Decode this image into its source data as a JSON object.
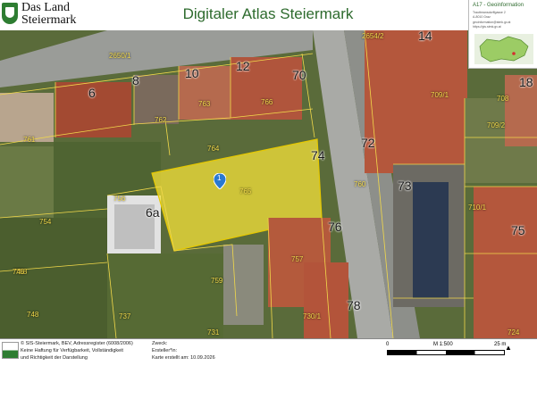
{
  "header": {
    "logo_line1": "Das Land",
    "logo_line2": "Steiermark",
    "title": "Digitaler Atlas Steiermark"
  },
  "infobox": {
    "title": "A17 - Geoinformation",
    "address1": "Trauttmansdorffgasse 2",
    "address2": "A-8010 Graz",
    "email": "geoinformation@stmk.gv.at",
    "url": "https://gis.stmk.gv.at"
  },
  "map": {
    "marker_label": "1",
    "house_numbers": [
      "14",
      "12",
      "10",
      "8",
      "6",
      "72",
      "70",
      "74",
      "76",
      "78",
      "73",
      "75",
      "6a",
      "18"
    ],
    "parcels": [
      "2650/1",
      "2654/2",
      "763",
      "766",
      "764",
      "765",
      "762",
      "761",
      "760",
      "756",
      "754",
      "757",
      "759",
      "758",
      "737",
      "731",
      "746",
      "748",
      "730/1",
      "709/1",
      "709/2",
      "708",
      "710/1",
      "724"
    ]
  },
  "footer": {
    "source_line1": "© SIS-Steiermark, BEV, Adressregister (6008/2006)",
    "source_line2": "Keine Haftung für Verfügbarkeit, Vollständigkeit",
    "source_line3": "und Richtigkeit der Darstellung",
    "zweck_label": "Zweck:",
    "ersteller_label": "Ersteller*in:",
    "erstellt_label": "Karte erstellt am: 10.09.2026",
    "scale_label": "M 1:500",
    "scale_zero": "0",
    "scale_end": "25 m"
  },
  "colors": {
    "title_green": "#2e6b2e",
    "parcel_line": "#f2d94a",
    "highlight_fill": "#f5e23a",
    "marker": "#2979d1"
  }
}
